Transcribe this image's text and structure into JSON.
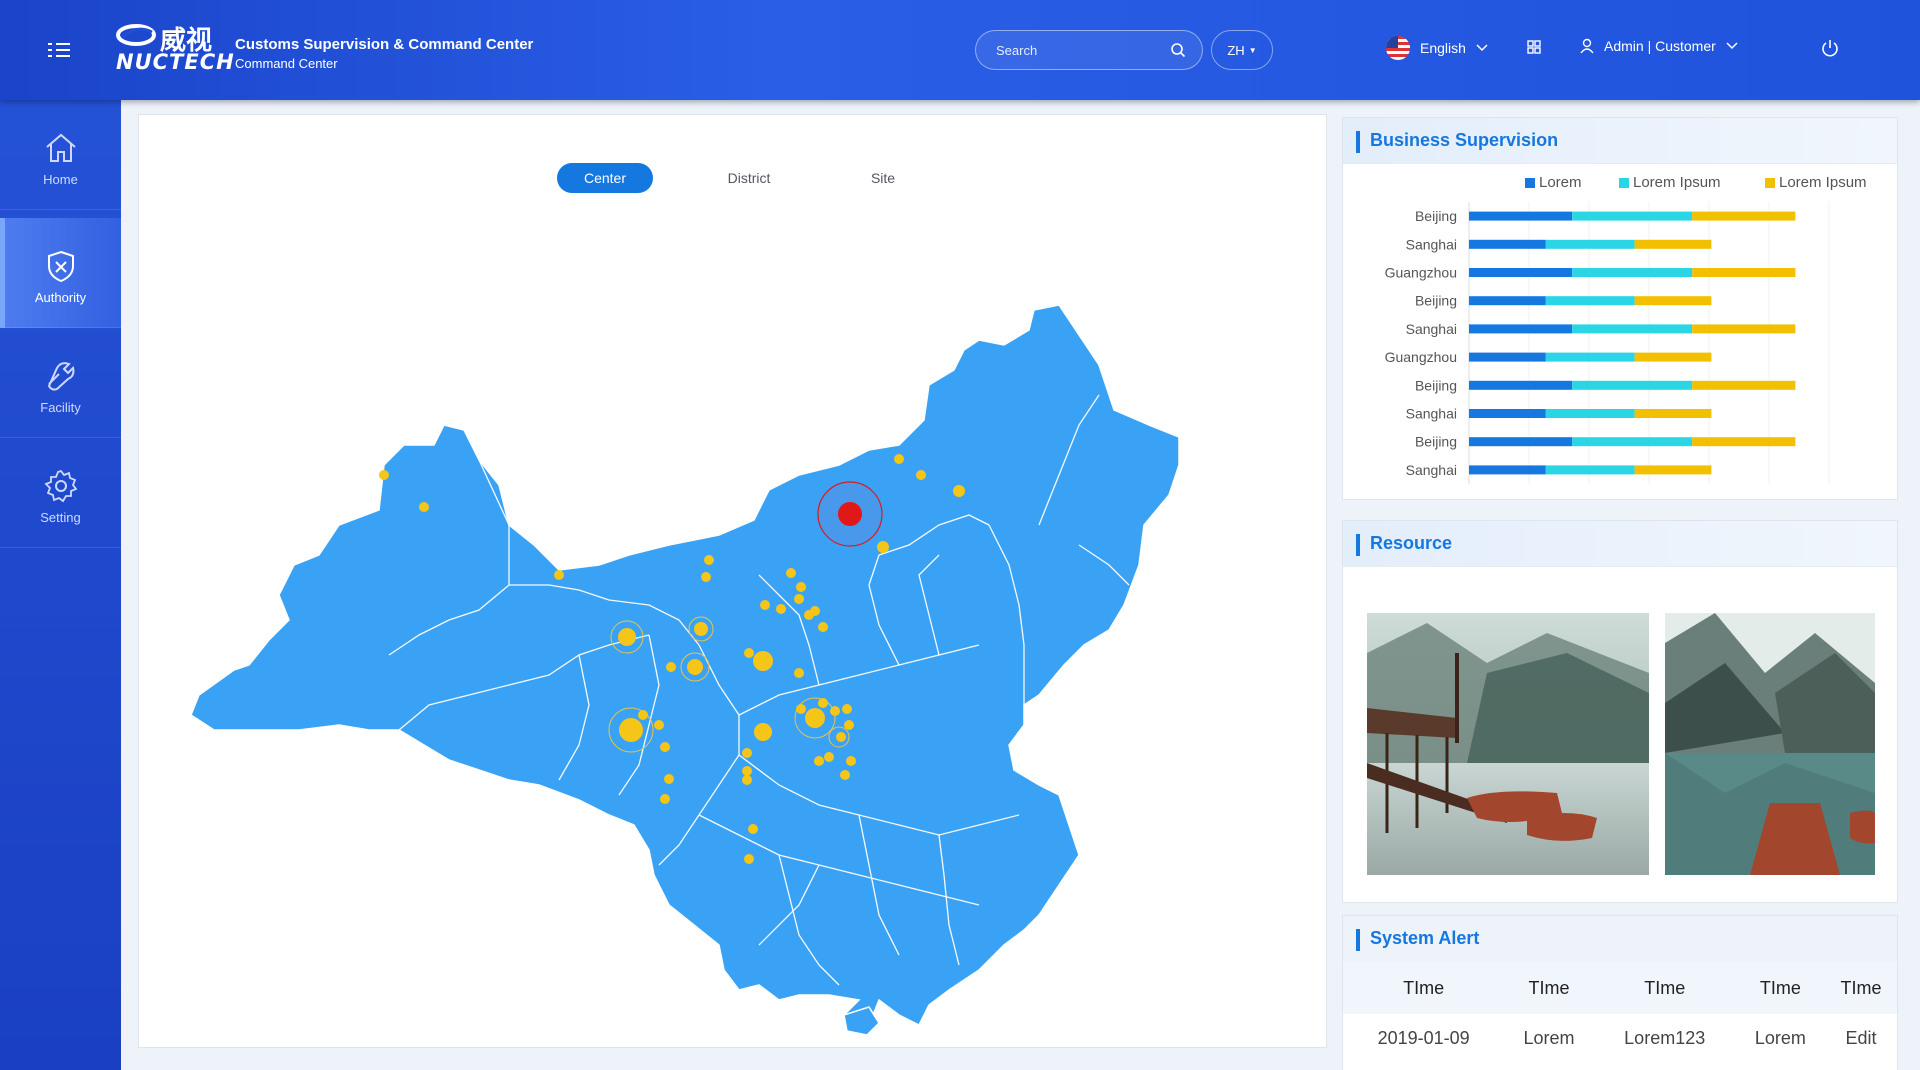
{
  "header": {
    "logo_cn": "威视",
    "logo_brand": "NUCTECH",
    "title_line1": "Customs Supervision & Command Center",
    "title_line2": "Command Center",
    "search_placeholder": "Search",
    "lang_short": "ZH",
    "language": "English",
    "user": "Admin | Customer"
  },
  "sidebar": {
    "items": [
      {
        "label": "Home",
        "icon": "home-icon"
      },
      {
        "label": "Authority",
        "icon": "shield-icon"
      },
      {
        "label": "Facility",
        "icon": "wrench-icon"
      },
      {
        "label": "Setting",
        "icon": "gear-icon"
      }
    ],
    "active_index": 1
  },
  "map_panel": {
    "tabs": [
      "Center",
      "District",
      "Site"
    ],
    "active_tab": "Center"
  },
  "business": {
    "title": "Business Supervision",
    "chart_data": {
      "type": "bar",
      "orientation": "horizontal",
      "stacked": true,
      "categories": [
        "Beijing",
        "Sanghai",
        "Guangzhou",
        "Beijing",
        "Sanghai",
        "Guangzhou",
        "Beijing",
        "Sanghai",
        "Beijing",
        "Sanghai"
      ],
      "series": [
        {
          "name": "Lorem",
          "color": "#1577e0",
          "values": [
            430,
            320,
            430,
            320,
            430,
            320,
            430,
            320,
            430,
            320
          ]
        },
        {
          "name": "Lorem Ipsum",
          "color": "#2ad6e6",
          "values": [
            500,
            370,
            500,
            370,
            500,
            370,
            500,
            370,
            500,
            370
          ]
        },
        {
          "name": "Lorem Ipsum",
          "color": "#f2c000",
          "values": [
            430,
            320,
            430,
            320,
            430,
            320,
            430,
            320,
            430,
            320
          ]
        }
      ],
      "xticks": [
        "0",
        "250",
        "500",
        "750",
        "1,000",
        "1,250",
        "1,500"
      ],
      "xlim": [
        0,
        1500
      ],
      "grid": true,
      "legend": "top"
    }
  },
  "resource": {
    "title": "Resource"
  },
  "alert": {
    "title": "System Alert",
    "columns": [
      "TIme",
      "TIme",
      "TIme",
      "TIme",
      "TIme"
    ],
    "rows": [
      [
        "2019-01-09",
        "Lorem",
        "Lorem123",
        "Lorem",
        "Edit"
      ]
    ]
  },
  "colors": {
    "accent": "#1577e0",
    "header": "#1f4fd8",
    "map_fill": "#3aa2f5",
    "marker": "#f5c518",
    "hot_marker": "#e01818"
  }
}
